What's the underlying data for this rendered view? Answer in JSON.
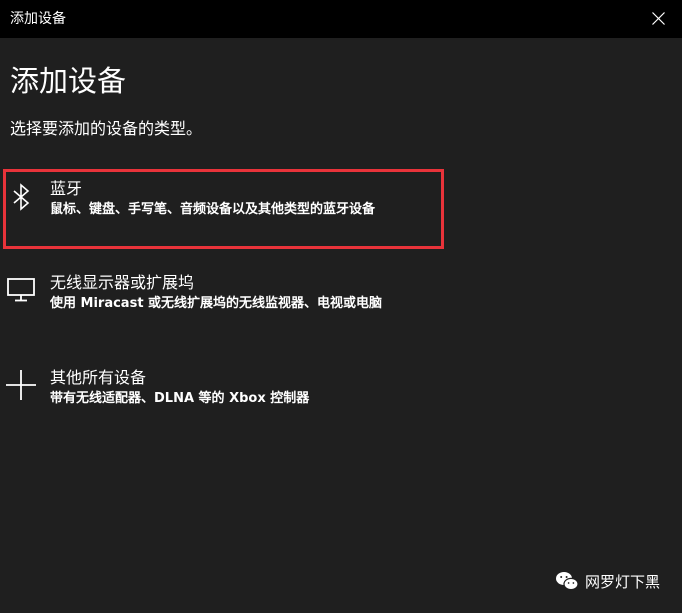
{
  "window": {
    "title": "添加设备"
  },
  "page": {
    "heading": "添加设备",
    "subheading": "选择要添加的设备的类型。"
  },
  "options": [
    {
      "icon": "bluetooth-icon",
      "title": "蓝牙",
      "description": "鼠标、键盘、手写笔、音频设备以及其他类型的蓝牙设备",
      "highlighted": true
    },
    {
      "icon": "monitor-icon",
      "title": "无线显示器或扩展坞",
      "description": "使用 Miracast 或无线扩展坞的无线监视器、电视或电脑",
      "highlighted": false
    },
    {
      "icon": "plus-icon",
      "title": "其他所有设备",
      "description": "带有无线适配器、DLNA 等的 Xbox 控制器",
      "highlighted": false
    }
  ],
  "colors": {
    "background": "#1f1f1f",
    "titlebar": "#000000",
    "highlight_border": "#e8333a",
    "text": "#ffffff"
  },
  "watermark": {
    "icon": "wechat-icon",
    "text": "网罗灯下黑"
  }
}
